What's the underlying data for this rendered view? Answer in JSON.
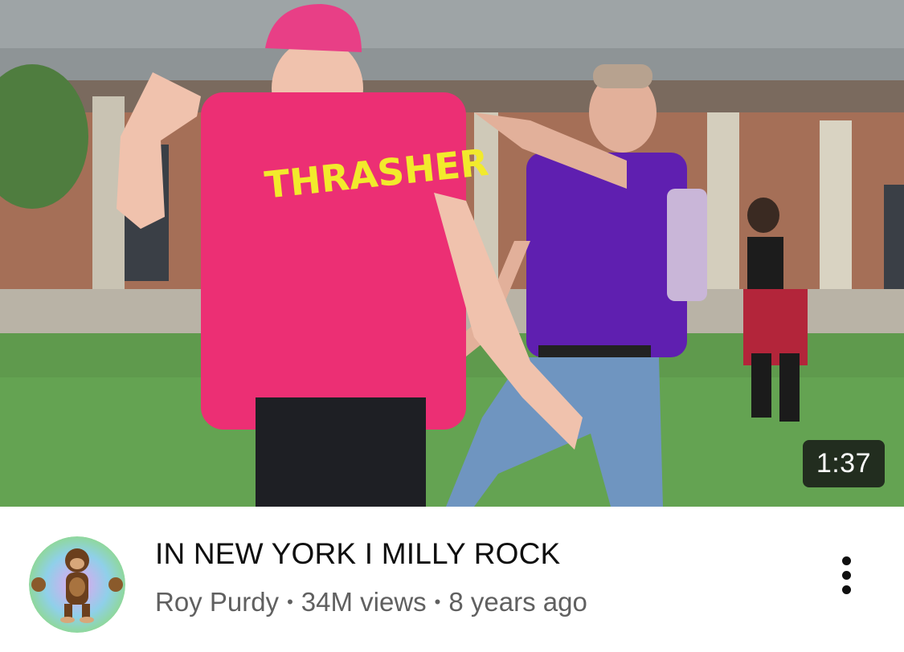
{
  "video": {
    "duration": "1:37",
    "title": "IN NEW YORK I MILLY ROCK",
    "channel": "Roy Purdy",
    "views": "34M views",
    "age": "8 years ago",
    "separator": "•"
  },
  "icons": {
    "more": "vertical-ellipsis-icon",
    "avatar": "monkey-avatar"
  },
  "colors": {
    "title": "#0f0f0f",
    "subtitle": "#606060",
    "duration_bg": "#141414"
  }
}
